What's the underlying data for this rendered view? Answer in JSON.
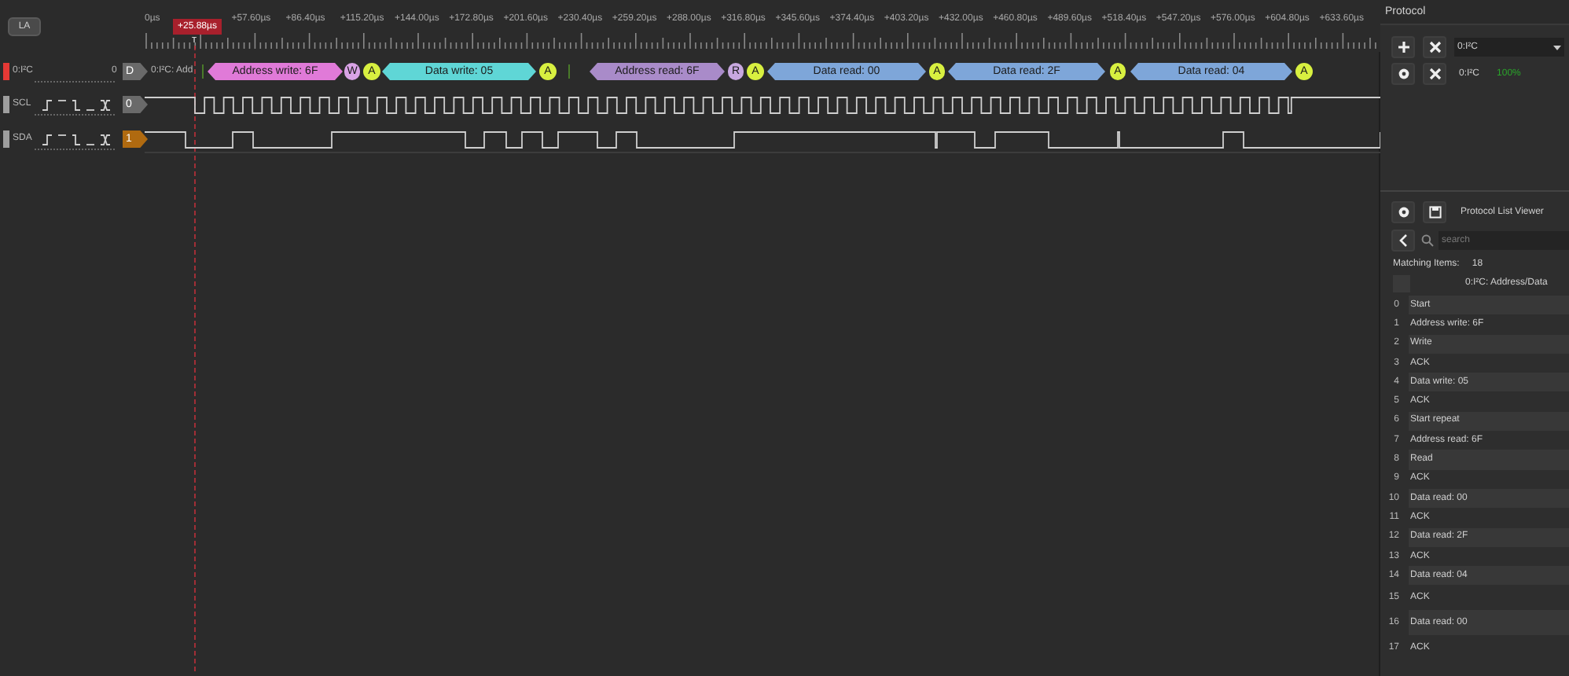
{
  "toolbar": {
    "mode_button": "LA"
  },
  "ruler": {
    "ticks": [
      "0µs",
      "+57.60µs",
      "+86.40µs",
      "+115.20µs",
      "+144.00µs",
      "+172.80µs",
      "+201.60µs",
      "+230.40µs",
      "+259.20µs",
      "+288.00µs",
      "+316.80µs",
      "+345.60µs",
      "+374.40µs",
      "+403.20µs",
      "+432.00µs",
      "+460.80µs",
      "+489.60µs",
      "+518.40µs",
      "+547.20µs",
      "+576.00µs",
      "+604.80µs",
      "+633.60µs"
    ],
    "cursor": {
      "label": "+25.88µs",
      "marker": "T"
    }
  },
  "channels": [
    {
      "kind": "decoder",
      "name": "0:I²C",
      "index": "0",
      "badge": "D",
      "color": "#e53935"
    },
    {
      "kind": "logic",
      "name": "SCL",
      "badge": "0",
      "color": "#9e9e9e"
    },
    {
      "kind": "logic",
      "name": "SDA",
      "badge": "1",
      "color": "#9e9e9e"
    }
  ],
  "decoder_row": {
    "prefix": "0:I²C: Add",
    "segments": [
      {
        "label": "Address write: 6F",
        "color": "#e07ad8"
      },
      {
        "label": "W",
        "color": "#d9a3e6"
      },
      {
        "label": "A",
        "color": "#d8f040"
      },
      {
        "label": "Data write: 05",
        "color": "#5fd6d6"
      },
      {
        "label": "A",
        "color": "#d8f040"
      },
      {
        "label": "Address read: 6F",
        "color": "#a98bc9"
      },
      {
        "label": "R",
        "color": "#c8a8e0"
      },
      {
        "label": "A",
        "color": "#d8f040"
      },
      {
        "label": "Data read: 00",
        "color": "#7ea6d9"
      },
      {
        "label": "A",
        "color": "#d8f040"
      },
      {
        "label": "Data read: 2F",
        "color": "#7ea6d9"
      },
      {
        "label": "A",
        "color": "#d8f040"
      },
      {
        "label": "Data read: 04",
        "color": "#7ea6d9"
      },
      {
        "label": "A",
        "color": "#d8f040"
      }
    ]
  },
  "protocol_panel": {
    "title": "Protocol",
    "selector": "0:I²C",
    "decoder": {
      "name": "0:I²C",
      "progress": "100%"
    }
  },
  "list_viewer": {
    "title": "Protocol List Viewer",
    "search": {
      "placeholder": "search"
    },
    "matching_label": "Matching Items:",
    "matching_count": "18",
    "column": "0:I²C: Address/Data",
    "rows": [
      {
        "index": "0",
        "text": "Start"
      },
      {
        "index": "1",
        "text": "Address write: 6F"
      },
      {
        "index": "2",
        "text": "Write"
      },
      {
        "index": "3",
        "text": "ACK"
      },
      {
        "index": "4",
        "text": "Data write: 05"
      },
      {
        "index": "5",
        "text": "ACK"
      },
      {
        "index": "6",
        "text": "Start repeat"
      },
      {
        "index": "7",
        "text": "Address read: 6F"
      },
      {
        "index": "8",
        "text": "Read"
      },
      {
        "index": "9",
        "text": "ACK"
      },
      {
        "index": "10",
        "text": "Data read: 00"
      },
      {
        "index": "11",
        "text": "ACK"
      },
      {
        "index": "12",
        "text": "Data read: 2F"
      },
      {
        "index": "13",
        "text": "ACK"
      },
      {
        "index": "14",
        "text": "Data read: 04"
      },
      {
        "index": "15",
        "text": "ACK"
      },
      {
        "index": "16",
        "text": "Data read: 00"
      },
      {
        "index": "17",
        "text": "ACK"
      }
    ]
  }
}
